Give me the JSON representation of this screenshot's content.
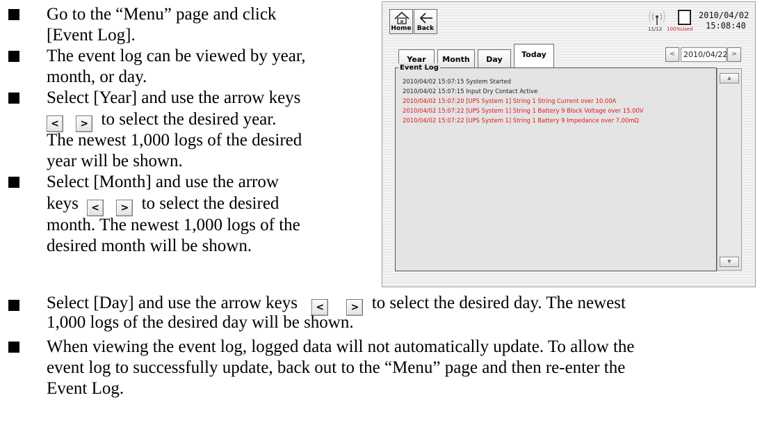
{
  "instructions": {
    "b1": {
      "line1": "Go to the “Menu” page and click",
      "line2": "[Event Log]."
    },
    "b2": {
      "line1": "The event log can be viewed by year,",
      "line2": "month, or day."
    },
    "b3": {
      "line1": "Select [Year] and use the arrow keys",
      "line2_suffix": "to select the desired year.",
      "line3": "The newest 1,000 logs of the desired",
      "line4": "year will be shown."
    },
    "b4": {
      "line1": "Select [Month] and use the arrow",
      "line2_prefix": "keys",
      "line2_suffix": "to select the desired",
      "line3": "month. The newest 1,000 logs of the",
      "line4": "desired month will be shown."
    },
    "b5": {
      "line1_prefix": "Select [Day] and use the arrow keys",
      "line1_suffix": "to select the desired day. The newest",
      "line2": "1,000 logs of the desired day will be shown."
    },
    "b6": {
      "line1": "When viewing the event log, logged data will not automatically update. To allow the",
      "line2": "event log to successfully update, back out to the “Menu” page and then re-enter the",
      "line3": "Event Log."
    },
    "key_left": "<",
    "key_right": ">"
  },
  "device": {
    "home_label": "Home",
    "back_label": "Back",
    "signal_count": "11/12",
    "storage_used": "100%Used",
    "date": "2010/04/02",
    "time": "15:08:40",
    "tabs": [
      "Year",
      "Month",
      "Day",
      "Today"
    ],
    "active_tab": "Today",
    "nav_prev": "<",
    "nav_next": ">",
    "nav_date": "2010/04/22",
    "log_title": "Event Log",
    "scroll_up": "▲",
    "scroll_down": "▼",
    "log_entries": [
      {
        "text": "2010/04/02 15:07:15 System Started",
        "alarm": false
      },
      {
        "text": "2010/04/02 15:07:15 Input Dry Contact Active",
        "alarm": false
      },
      {
        "text": "2010/04/02 15:07:20 [UPS System 1] String 1 String Current over 10.00A",
        "alarm": true
      },
      {
        "text": "2010/04/02 15:07:22 [UPS System 1] String 1 Battery 9 Block Voltage over 15.00V",
        "alarm": true
      },
      {
        "text": "2010/04/02 15:07:22 [UPS System 1] String 1 Battery 9 Impedance over 7.00mΩ",
        "alarm": true
      }
    ],
    "colors": {
      "alarm_text": "#e01818",
      "normal_text": "#222222"
    }
  }
}
